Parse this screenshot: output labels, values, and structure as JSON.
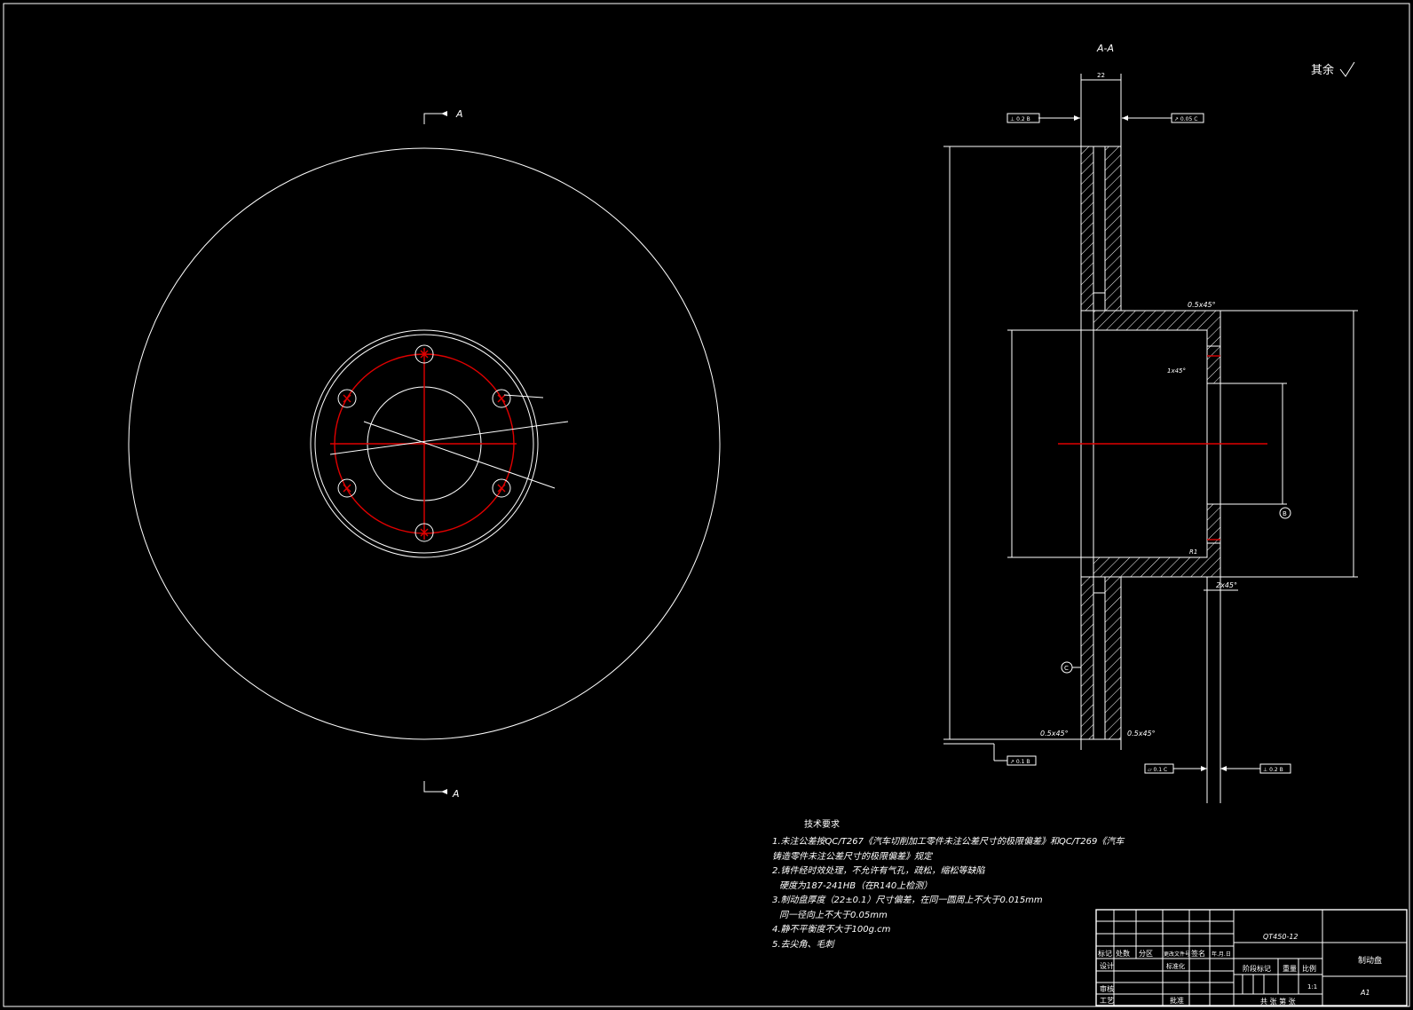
{
  "section_label": "A-A",
  "section_marker": "A",
  "roughness_note": "其余",
  "dims": {
    "thickness": "22",
    "datum_b": "B",
    "datum_c": "C",
    "chamfer_1": "0.5x45°",
    "chamfer_2": "2x45°",
    "chamfer_3": "1x45°",
    "radius": "R1",
    "fcf_top_left": "⊥ 0.2 B",
    "fcf_top_right": "↗ 0.05 C",
    "fcf_bottom_left": "↗ 0.1 B",
    "fcf_bottom_mid": "▱ 0.1 C",
    "fcf_bottom_right": "⊥ 0.2 B"
  },
  "tech_notes": {
    "title": "技术要求",
    "lines": [
      "1.未注公差按QC/T267《汽车切削加工零件未注公差尺寸的极限偏差》和QC/T269《汽车",
      "铸造零件未注公差尺寸的极限偏差》规定",
      "2.铸件经时效处理，不允许有气孔，疏松，缩松等缺陷",
      "硬度为187-241HB（在R140上检测）",
      "3.制动盘厚度（22±0.1）尺寸偏差，在同一圆周上不大于0.015mm",
      "同一径向上不大于0.05mm",
      "4.静不平衡度不大于100g.cm",
      "5.去尖角、毛刺"
    ]
  },
  "title_block": {
    "material": "QT450-12",
    "part_name": "制动盘",
    "sheet_size": "A1",
    "scale": "1:1",
    "h_mark": "标记",
    "h_count": "处数",
    "h_zone": "分区",
    "h_docno": "更改文件号",
    "h_sign": "签名",
    "h_date": "年.月.日",
    "design": "设计",
    "standard": "标准化",
    "stage_mark": "阶段标记",
    "weight": "重量",
    "ratio": "比例",
    "check": "审核",
    "process": "工艺",
    "approve": "批准",
    "sheets": "共  张  第  张"
  }
}
